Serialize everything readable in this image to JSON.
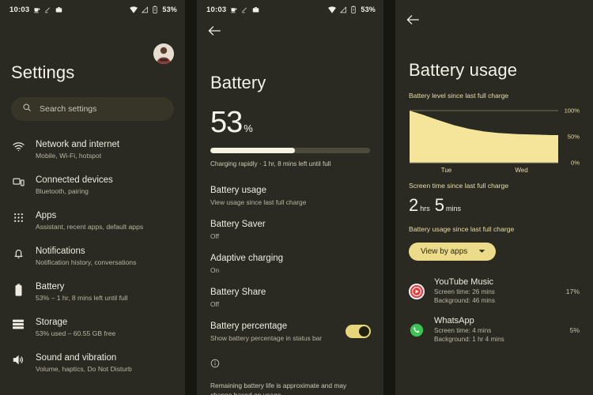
{
  "statusbar": {
    "time": "10:03",
    "battery_percent": "53%",
    "left_icons": [
      "coffee-icon",
      "pencil-icon",
      "camera-icon"
    ],
    "right_icons": [
      "wifi-icon",
      "cellular-signal-icon",
      "battery-icon"
    ]
  },
  "settings_panel": {
    "title": "Settings",
    "avatar": "user-avatar",
    "search": {
      "placeholder": "Search settings",
      "icon": "search-icon"
    },
    "items": [
      {
        "label": "Network and internet",
        "sub": "Mobile, Wi-Fi, hotspot",
        "icon": "wifi-icon"
      },
      {
        "label": "Connected devices",
        "sub": "Bluetooth, pairing",
        "icon": "devices-icon"
      },
      {
        "label": "Apps",
        "sub": "Assistant, recent apps, default apps",
        "icon": "apps-grid-icon"
      },
      {
        "label": "Notifications",
        "sub": "Notification history, conversations",
        "icon": "bell-icon"
      },
      {
        "label": "Battery",
        "sub": "53% – 1 hr, 8 mins left until full",
        "icon": "battery-icon"
      },
      {
        "label": "Storage",
        "sub": "53% used – 60.55 GB free",
        "icon": "storage-icon"
      },
      {
        "label": "Sound and vibration",
        "sub": "Volume, haptics, Do Not Disturb",
        "icon": "volume-icon"
      }
    ]
  },
  "battery_panel": {
    "back": "back-arrow-icon",
    "title": "Battery",
    "level_number": "53",
    "level_symbol": "%",
    "level_fill_percent": 53,
    "charge_note": "Charging rapidly · 1 hr, 8 mins left until full",
    "options": [
      {
        "label": "Battery usage",
        "sub": "View usage since last full charge",
        "toggle": null
      },
      {
        "label": "Battery Saver",
        "sub": "Off",
        "toggle": null
      },
      {
        "label": "Adaptive charging",
        "sub": "On",
        "toggle": null
      },
      {
        "label": "Battery Share",
        "sub": "Off",
        "toggle": null
      },
      {
        "label": "Battery percentage",
        "sub": "Show battery percentage in status bar",
        "toggle": "on"
      }
    ],
    "info_icon": "info-icon",
    "info_note": "Remaining battery life is approximate and may change based on usage"
  },
  "usage_panel": {
    "back": "back-arrow-icon",
    "title": "Battery usage",
    "chart_caption": "Battery level since last full charge",
    "screen_time_heading": "Screen time since last full charge",
    "screen_time": {
      "hours": "2",
      "hours_unit": "hrs",
      "mins": "5",
      "mins_unit": "mins"
    },
    "usage_heading": "Battery usage since last full charge",
    "view_by": {
      "label": "View by apps",
      "icon": "chevron-down-icon"
    },
    "apps": [
      {
        "name": "YouTube Music",
        "screen_time": "Screen time: 26 mins",
        "background": "Background: 46 mins",
        "percent": "17%",
        "icon": "youtube-music-icon",
        "color": "#e8393b"
      },
      {
        "name": "WhatsApp",
        "screen_time": "Screen time: 4 mins",
        "background": "Background: 1 hr 4 mins",
        "percent": "5%",
        "icon": "whatsapp-icon",
        "color": "#3bc454"
      }
    ]
  },
  "chart_data": {
    "type": "area",
    "title": "Battery level since last full charge",
    "xlabel": "",
    "ylabel": "Battery level",
    "ylim": [
      0,
      100
    ],
    "ytick_labels": [
      "100%",
      "50%",
      "0%"
    ],
    "ytick_values": [
      100,
      50,
      0
    ],
    "categories": [
      "Tue",
      "Wed"
    ],
    "grid": false,
    "legend": "none",
    "accent_color": "#f5e59a",
    "series": [
      {
        "name": "Tue",
        "x": [
          0,
          0.18,
          0.38,
          0.6,
          0.8,
          1.0
        ],
        "values": [
          100,
          92,
          82,
          72,
          65,
          60
        ]
      },
      {
        "name": "Wed",
        "x": [
          1.0,
          1.2,
          1.45,
          1.7,
          1.9,
          2.0
        ],
        "values": [
          60,
          57,
          55,
          54,
          53,
          53
        ]
      }
    ]
  }
}
